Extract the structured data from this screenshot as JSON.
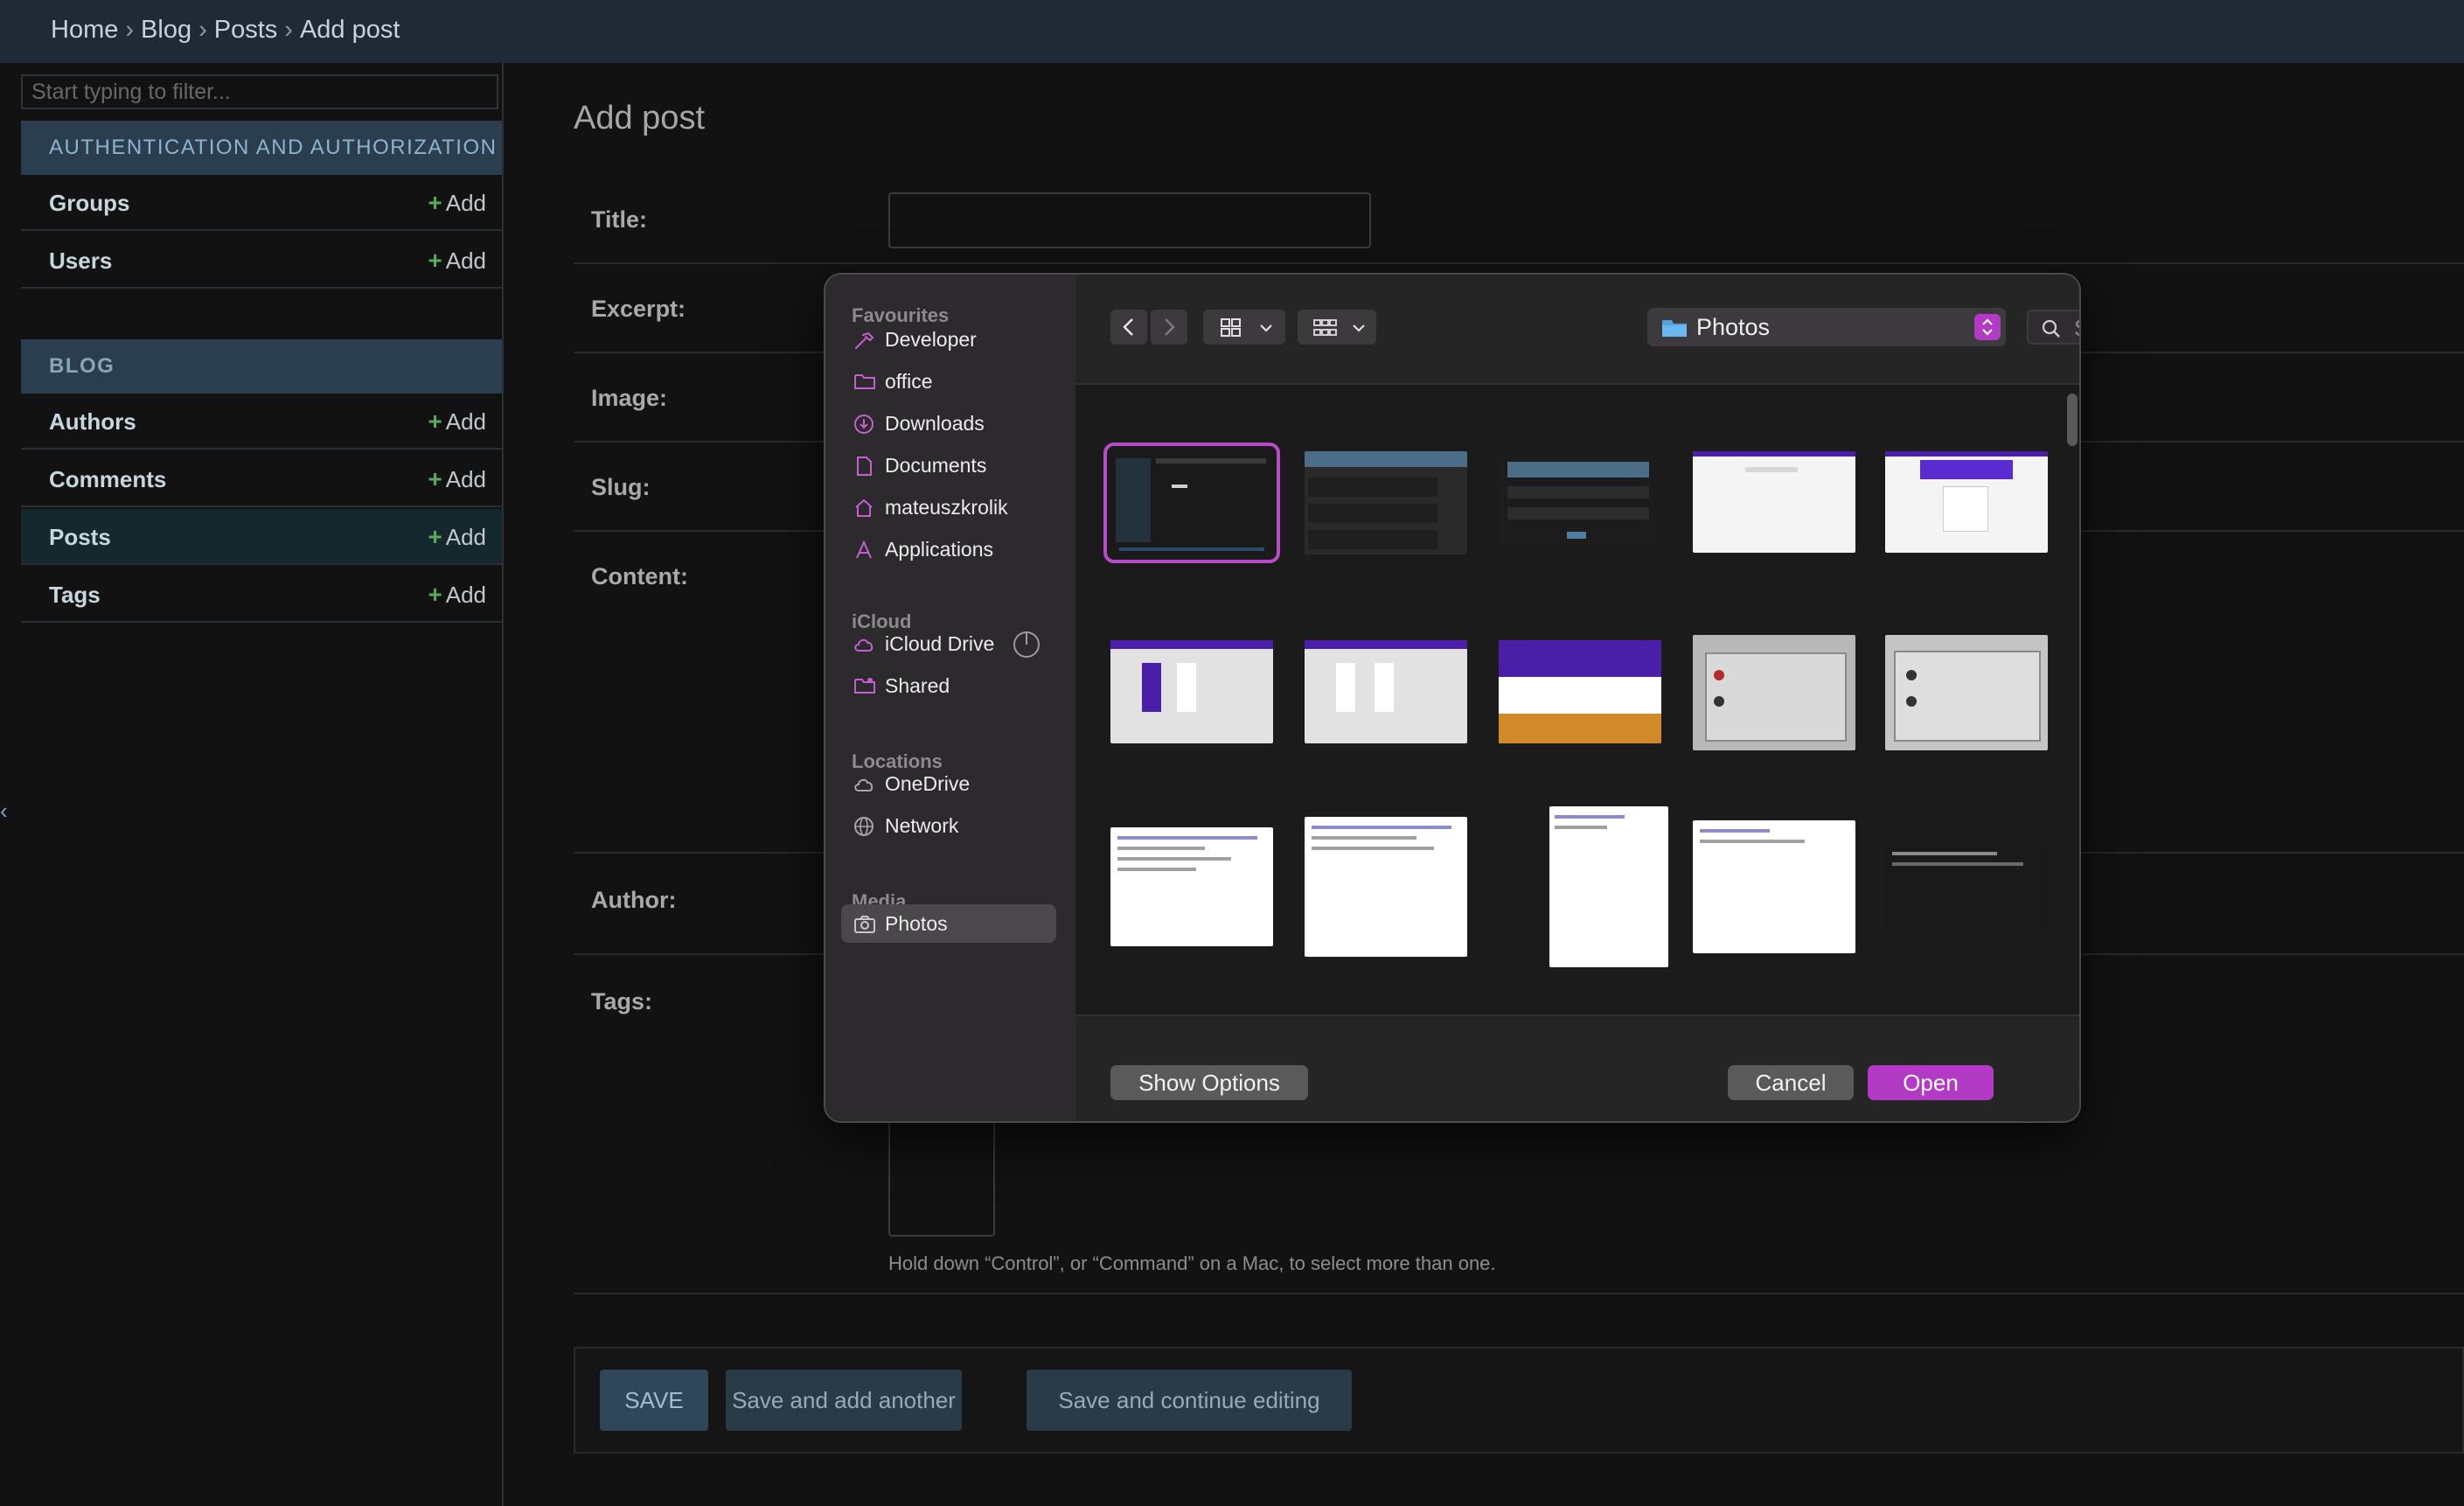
{
  "breadcrumb": {
    "items": [
      "Home",
      "Blog",
      "Posts",
      "Add post"
    ],
    "separator": "›"
  },
  "sidebar": {
    "filter_placeholder": "Start typing to filter...",
    "collapse_glyph": "‹",
    "modules": [
      {
        "title": "AUTHENTICATION AND AUTHORIZATION",
        "items": [
          {
            "label": "Groups",
            "add": "Add"
          },
          {
            "label": "Users",
            "add": "Add"
          }
        ]
      },
      {
        "title": "BLOG",
        "items": [
          {
            "label": "Authors",
            "add": "Add"
          },
          {
            "label": "Comments",
            "add": "Add"
          },
          {
            "label": "Posts",
            "add": "Add",
            "active": true
          },
          {
            "label": "Tags",
            "add": "Add"
          }
        ]
      }
    ]
  },
  "form": {
    "title": "Add post",
    "fields": {
      "title": "Title:",
      "excerpt": "Excerpt:",
      "image": "Image:",
      "slug": "Slug:",
      "content": "Content:",
      "author": "Author:",
      "tags": "Tags:"
    },
    "tags_help": "Hold down “Control”, or “Command” on a Mac, to select more than one.",
    "buttons": {
      "save": "SAVE",
      "save_add_another": "Save and add another",
      "save_continue": "Save and continue editing"
    }
  },
  "dialog": {
    "sidebar": {
      "favourites_title": "Favourites",
      "favourites": [
        {
          "label": "Developer",
          "icon": "hammer-icon"
        },
        {
          "label": "office",
          "icon": "folder-icon"
        },
        {
          "label": "Downloads",
          "icon": "download-icon"
        },
        {
          "label": "Documents",
          "icon": "document-icon"
        },
        {
          "label": "mateuszkrolik",
          "icon": "home-icon"
        },
        {
          "label": "Applications",
          "icon": "applications-icon"
        }
      ],
      "icloud_title": "iCloud",
      "icloud": [
        {
          "label": "iCloud Drive",
          "icon": "cloud-icon"
        },
        {
          "label": "Shared",
          "icon": "shared-folder-icon"
        }
      ],
      "locations_title": "Locations",
      "locations": [
        {
          "label": "OneDrive",
          "icon": "cloud-icon"
        },
        {
          "label": "Network",
          "icon": "globe-icon"
        }
      ],
      "media_title": "Media",
      "media": [
        {
          "label": "Photos",
          "icon": "camera-icon",
          "selected": true
        }
      ]
    },
    "location": "Photos",
    "search_placeholder": "Search",
    "buttons": {
      "show_options": "Show Options",
      "cancel": "Cancel",
      "open": "Open"
    },
    "accent_color": "#b33ac4"
  }
}
